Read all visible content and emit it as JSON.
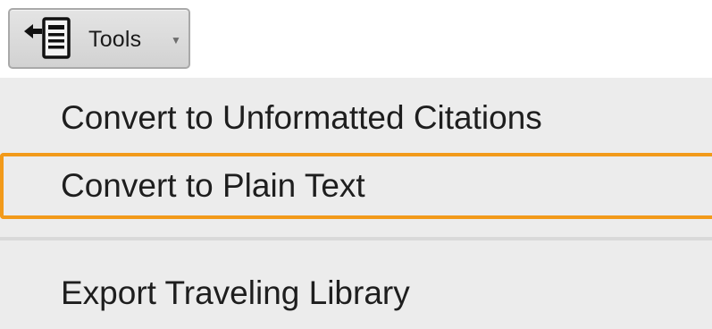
{
  "toolbar": {
    "tools_label": "Tools",
    "tools_icon": "document-import-icon",
    "caret_icon": "chevron-down-icon"
  },
  "menu": {
    "items": [
      {
        "label": "Convert to Unformatted Citations",
        "highlighted": false
      },
      {
        "label": "Convert to Plain Text",
        "highlighted": true
      },
      {
        "label": "Export Traveling Library",
        "highlighted": false
      }
    ]
  },
  "colors": {
    "highlight_border": "#f29a1a",
    "menu_background": "#ececec",
    "separator": "#d9d9d9"
  }
}
